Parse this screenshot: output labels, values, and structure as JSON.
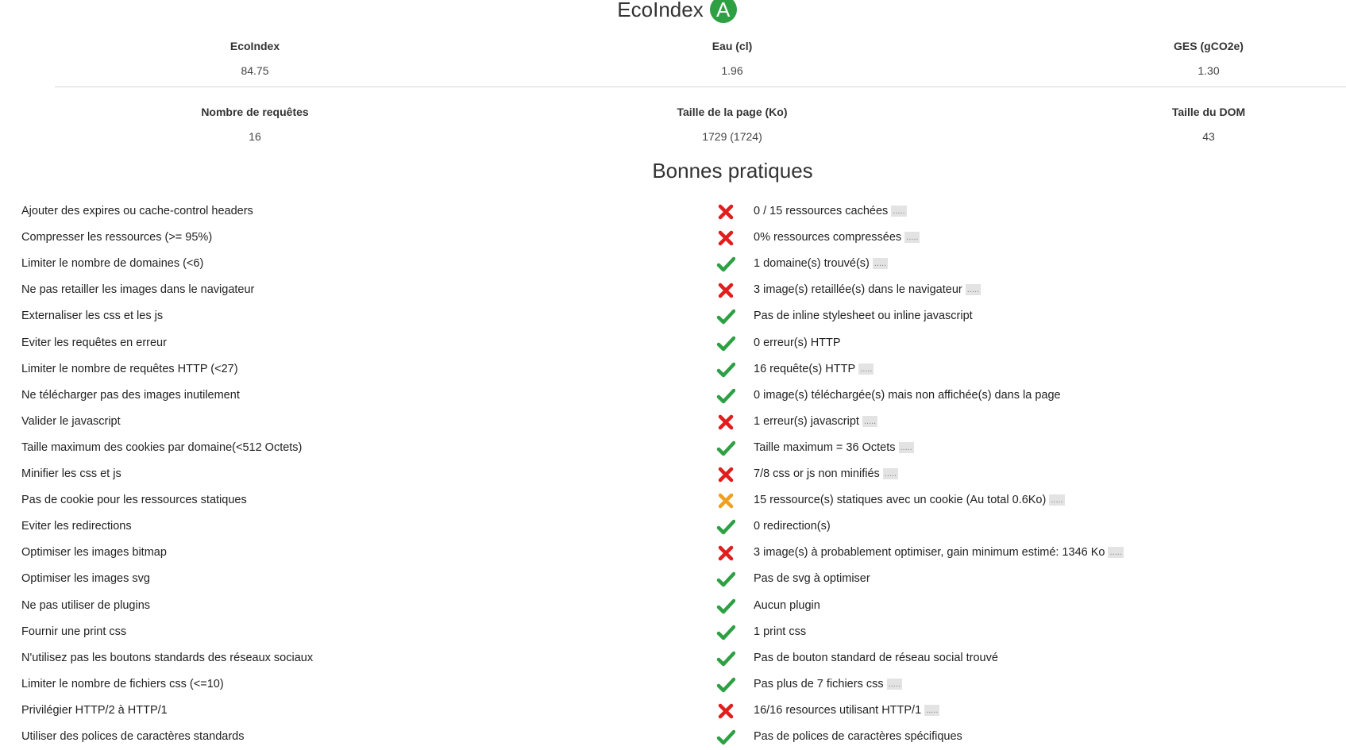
{
  "header": {
    "title": "EcoIndex",
    "grade": "A",
    "grade_color": "#2ea043"
  },
  "metrics": [
    {
      "label": "EcoIndex",
      "value": "84.75"
    },
    {
      "label": "Eau (cl)",
      "value": "1.96"
    },
    {
      "label": "GES (gCO2e)",
      "value": "1.30"
    },
    {
      "label": "Nombre de requêtes",
      "value": "16"
    },
    {
      "label": "Taille de la page (Ko)",
      "value": "1729 (1724)"
    },
    {
      "label": "Taille du DOM",
      "value": "43"
    }
  ],
  "section_title": "Bonnes pratiques",
  "details_label": ".....",
  "status_colors": {
    "ok": "#2ea043",
    "fail": "#e11d1d",
    "warn": "#f0a020"
  },
  "practices": [
    {
      "label": "Ajouter des expires ou cache-control headers",
      "status": "fail",
      "result": "0 / 15 ressources cachées",
      "has_details": true
    },
    {
      "label": "Compresser les ressources (>= 95%)",
      "status": "fail",
      "result": "0% ressources compressées",
      "has_details": true
    },
    {
      "label": "Limiter le nombre de domaines (<6)",
      "status": "ok",
      "result": "1 domaine(s) trouvé(s)",
      "has_details": true
    },
    {
      "label": "Ne pas retailler les images dans le navigateur",
      "status": "fail",
      "result": "3 image(s) retaillée(s) dans le navigateur",
      "has_details": true
    },
    {
      "label": "Externaliser les css et les js",
      "status": "ok",
      "result": "Pas de inline stylesheet ou inline javascript",
      "has_details": false
    },
    {
      "label": "Eviter les requêtes en erreur",
      "status": "ok",
      "result": "0 erreur(s) HTTP",
      "has_details": false
    },
    {
      "label": "Limiter le nombre de requêtes HTTP (<27)",
      "status": "ok",
      "result": "16 requête(s) HTTP",
      "has_details": true
    },
    {
      "label": "Ne télécharger pas des images inutilement",
      "status": "ok",
      "result": "0 image(s) téléchargée(s) mais non affichée(s) dans la page",
      "has_details": false
    },
    {
      "label": "Valider le javascript",
      "status": "fail",
      "result": "1 erreur(s) javascript",
      "has_details": true
    },
    {
      "label": "Taille maximum des cookies par domaine(<512 Octets)",
      "status": "ok",
      "result": "Taille maximum = 36 Octets",
      "has_details": true
    },
    {
      "label": "Minifier les css et js",
      "status": "fail",
      "result": "7/8 css or js non minifiés",
      "has_details": true
    },
    {
      "label": "Pas de cookie pour les ressources statiques",
      "status": "warn",
      "result": "15 ressource(s) statiques avec un cookie (Au total 0.6Ko)",
      "has_details": true
    },
    {
      "label": "Eviter les redirections",
      "status": "ok",
      "result": "0 redirection(s)",
      "has_details": false
    },
    {
      "label": "Optimiser les images bitmap",
      "status": "fail",
      "result": "3 image(s) à probablement optimiser, gain minimum estimé: 1346 Ko",
      "has_details": true
    },
    {
      "label": "Optimiser les images svg",
      "status": "ok",
      "result": "Pas de svg à optimiser",
      "has_details": false
    },
    {
      "label": "Ne pas utiliser de plugins",
      "status": "ok",
      "result": "Aucun plugin",
      "has_details": false
    },
    {
      "label": "Fournir une print css",
      "status": "ok",
      "result": "1 print css",
      "has_details": false
    },
    {
      "label": "N'utilisez pas les boutons standards des réseaux sociaux",
      "status": "ok",
      "result": "Pas de bouton standard de réseau social trouvé",
      "has_details": false
    },
    {
      "label": "Limiter le nombre de fichiers css (<=10)",
      "status": "ok",
      "result": "Pas plus de 7 fichiers css",
      "has_details": true
    },
    {
      "label": "Privilégier HTTP/2 à HTTP/1",
      "status": "fail",
      "result": "16/16 resources utilisant HTTP/1",
      "has_details": true
    },
    {
      "label": "Utiliser des polices de caractères standards",
      "status": "ok",
      "result": "Pas de polices de caractères spécifiques",
      "has_details": false
    }
  ]
}
